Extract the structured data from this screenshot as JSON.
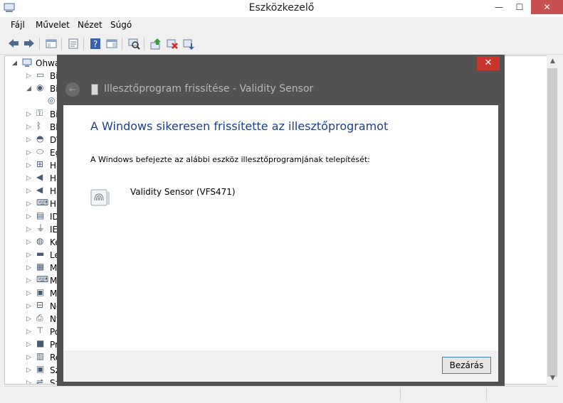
{
  "window": {
    "title": "Eszközkezelő",
    "minimize_glyph": "—",
    "maximize_glyph": "☐",
    "close_glyph": "✕"
  },
  "menu": [
    "Fájl",
    "Művelet",
    "Nézet",
    "Súgó"
  ],
  "toolbar": {
    "icons": [
      "back-arrow-icon",
      "forward-arrow-icon",
      "console-tree-icon",
      "properties-icon",
      "help-icon",
      "action-pane-icon",
      "scan-hardware-icon",
      "update-driver-icon",
      "disable-device-icon",
      "uninstall-device-icon"
    ]
  },
  "tree": {
    "root_label": "Ohwa",
    "items": [
      {
        "label": "Bi",
        "expander": "▷",
        "icon": "battery-icon"
      },
      {
        "label": "Bi",
        "expander": "◢",
        "icon": "biometric-icon"
      },
      {
        "label": "",
        "expander": "",
        "icon": "fingerprint-icon"
      },
      {
        "label": "Bi",
        "expander": "▷",
        "icon": "key-icon"
      },
      {
        "label": "Bl",
        "expander": "▷",
        "icon": "bluetooth-icon"
      },
      {
        "label": "DV",
        "expander": "▷",
        "icon": "dvd-drive-icon"
      },
      {
        "label": "Eg",
        "expander": "▷",
        "icon": "mouse-icon"
      },
      {
        "label": "Ha",
        "expander": "▷",
        "icon": "network-icon"
      },
      {
        "label": "Ha",
        "expander": "▷",
        "icon": "speaker-icon"
      },
      {
        "label": "Ha",
        "expander": "▷",
        "icon": "speaker-icon"
      },
      {
        "label": "HI",
        "expander": "▷",
        "icon": "hid-icon"
      },
      {
        "label": "ID",
        "expander": "▷",
        "icon": "ide-controller-icon"
      },
      {
        "label": "IE",
        "expander": "▷",
        "icon": "ieee1394-icon"
      },
      {
        "label": "Ke",
        "expander": "▷",
        "icon": "camera-icon"
      },
      {
        "label": "Le",
        "expander": "▷",
        "icon": "disk-drive-icon"
      },
      {
        "label": "M",
        "expander": "▷",
        "icon": "memory-icon"
      },
      {
        "label": "M",
        "expander": "▷",
        "icon": "keyboard-icon"
      },
      {
        "label": "M",
        "expander": "▷",
        "icon": "monitor-icon"
      },
      {
        "label": "Ne",
        "expander": "▷",
        "icon": "network-adapter-icon"
      },
      {
        "label": "Ny",
        "expander": "▷",
        "icon": "printer-icon"
      },
      {
        "label": "Po",
        "expander": "▷",
        "icon": "port-icon"
      },
      {
        "label": "Pr",
        "expander": "▷",
        "icon": "processor-icon"
      },
      {
        "label": "Re",
        "expander": "▷",
        "icon": "system-device-icon"
      },
      {
        "label": "Sz",
        "expander": "▷",
        "icon": "computer-icon"
      },
      {
        "label": "Sz",
        "expander": "▷",
        "icon": "usb-icon"
      }
    ]
  },
  "dialog": {
    "title": "Illesztőprogram frissítése - Validity Sensor",
    "close_glyph": "✕",
    "back_glyph": "←",
    "heading": "A Windows sikeresen frissítette az illesztőprogramot",
    "message": "A Windows befejezte az alábbi eszköz illesztőprogramjának telepítését:",
    "device_name": "Validity Sensor (VFS471)",
    "close_button": "Bezárás"
  },
  "scrollbar": {
    "up": "▲",
    "down": "▼"
  }
}
